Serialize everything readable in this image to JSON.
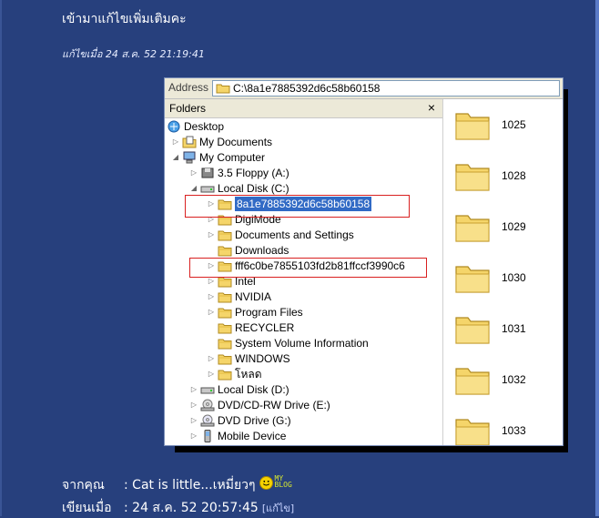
{
  "post": {
    "title": "เข้ามาแก้ไขเพิ่มเติมคะ",
    "edit_note": "แก้ไขเมื่อ 24 ส.ค. 52 21:19:41"
  },
  "explorer": {
    "address_label": "Address",
    "address_path": "C:\\8a1e7885392d6c58b60158",
    "folders_label": "Folders",
    "close_glyph": "×",
    "tree": [
      {
        "label": "Desktop",
        "icon": "desktop-icon",
        "indent": 0,
        "expander": ""
      },
      {
        "label": "My Documents",
        "icon": "my-documents-icon",
        "indent": 1,
        "expander": "▷"
      },
      {
        "label": "My Computer",
        "icon": "my-computer-icon",
        "indent": 1,
        "expander": "◢"
      },
      {
        "label": "3.5 Floppy (A:)",
        "icon": "floppy-icon",
        "indent": 2,
        "expander": "▷"
      },
      {
        "label": "Local Disk (C:)",
        "icon": "hard-disk-icon",
        "indent": 2,
        "expander": "◢"
      },
      {
        "label": "8a1e7885392d6c58b60158",
        "icon": "folder-icon",
        "indent": 3,
        "expander": "▷",
        "selected": true
      },
      {
        "label": "DigiMode",
        "icon": "folder-icon",
        "indent": 3,
        "expander": "▷"
      },
      {
        "label": "Documents and Settings",
        "icon": "folder-icon",
        "indent": 3,
        "expander": "▷"
      },
      {
        "label": "Downloads",
        "icon": "folder-icon",
        "indent": 3,
        "expander": ""
      },
      {
        "label": "fff6c0be7855103fd2b81ffccf3990c6",
        "icon": "folder-icon",
        "indent": 3,
        "expander": "▷"
      },
      {
        "label": "Intel",
        "icon": "folder-icon",
        "indent": 3,
        "expander": "▷"
      },
      {
        "label": "NVIDIA",
        "icon": "folder-icon",
        "indent": 3,
        "expander": "▷"
      },
      {
        "label": "Program Files",
        "icon": "folder-icon",
        "indent": 3,
        "expander": "▷"
      },
      {
        "label": "RECYCLER",
        "icon": "folder-icon",
        "indent": 3,
        "expander": ""
      },
      {
        "label": "System Volume Information",
        "icon": "folder-icon",
        "indent": 3,
        "expander": ""
      },
      {
        "label": "WINDOWS",
        "icon": "folder-icon",
        "indent": 3,
        "expander": "▷"
      },
      {
        "label": "โหลด",
        "icon": "folder-icon",
        "indent": 3,
        "expander": "▷"
      },
      {
        "label": "Local Disk (D:)",
        "icon": "hard-disk-icon",
        "indent": 2,
        "expander": "▷"
      },
      {
        "label": "DVD/CD-RW Drive (E:)",
        "icon": "cd-drive-icon",
        "indent": 2,
        "expander": "▷"
      },
      {
        "label": "DVD Drive (G:)",
        "icon": "dvd-drive-icon",
        "indent": 2,
        "expander": "▷"
      },
      {
        "label": "Mobile Device",
        "icon": "mobile-device-icon",
        "indent": 2,
        "expander": "▷"
      }
    ],
    "big_folders": [
      "1025",
      "1028",
      "1029",
      "1030",
      "1031",
      "1032",
      "1033"
    ]
  },
  "footer": {
    "from_label": "จากคุณ",
    "from_value": ": Cat is little...เหมี่ยวๆ",
    "myblog_top": "MY",
    "myblog_bottom": "BLOG",
    "written_label": "เขียนเมื่อ",
    "written_value": ": 24 ส.ค. 52 20:57:45",
    "edit_link": "[แก้ไข]"
  },
  "colors": {
    "page_bg": "#27407d",
    "selection": "#316ac5",
    "highlight_box": "#d92020",
    "folder_yellow": "#f5d56a"
  }
}
